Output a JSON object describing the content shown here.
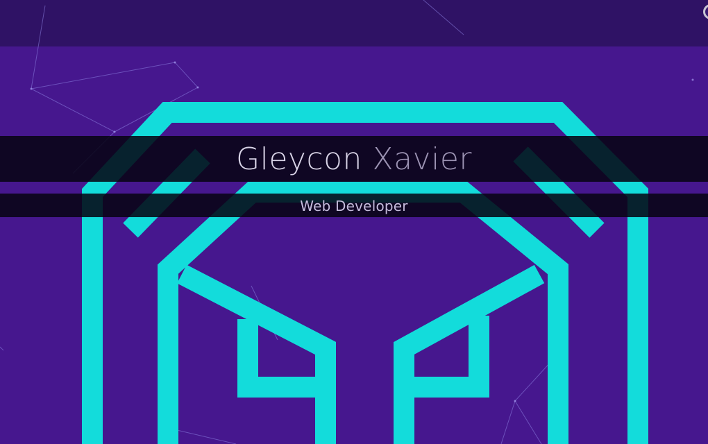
{
  "hero": {
    "first_name": "Gleycon",
    "last_name": "Xavier",
    "role": "Web Developer"
  },
  "icons": {
    "logo": "geometric-octagon-head-logo",
    "background": "particle-network-lines",
    "corner": "partial-circle-icon"
  },
  "colors": {
    "background": "#46178e",
    "top_bar": "#2f1265",
    "logo": "#13dcdb",
    "band": "#0b0720",
    "first_name": "#d8d3e6",
    "last_name": "#9b92b2",
    "role": "#c5bcdc"
  }
}
